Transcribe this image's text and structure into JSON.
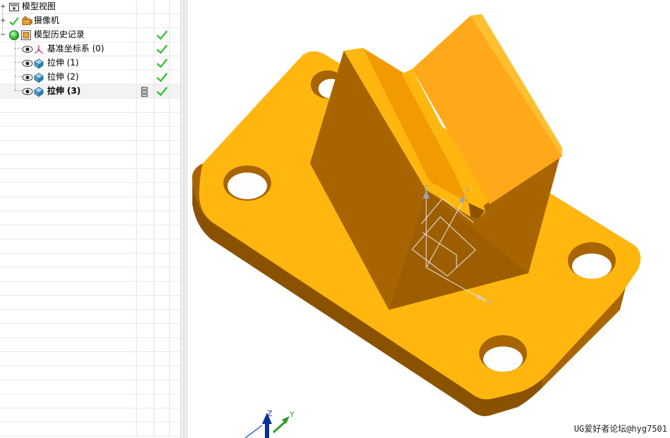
{
  "navigator": {
    "nodes": [
      {
        "label": "模型视图",
        "icon": "model-views-icon",
        "expander": "+"
      },
      {
        "label": "摄像机",
        "icon": "camera-icon",
        "expander": "+"
      },
      {
        "label": "模型历史记录",
        "icon": "model-history-icon",
        "expander": "-"
      },
      {
        "label": "基准坐标系 (0)",
        "icon": "datum-csys-icon"
      },
      {
        "label": "拉伸 (1)",
        "icon": "extrude-icon"
      },
      {
        "label": "拉伸 (2)",
        "icon": "extrude-icon"
      },
      {
        "label": "拉伸 (3)",
        "icon": "extrude-icon",
        "bold": true
      }
    ]
  },
  "viewport": {
    "triad": {
      "x": "X",
      "y": "Y",
      "z": "Z"
    },
    "view_triad": {
      "y": "Y",
      "z": "Z"
    },
    "watermark": "UG爱好者论坛@hyg7501"
  },
  "colors": {
    "part_top": "#FFB70F",
    "part_side": "#A86400",
    "part_side_dark": "#8A5200",
    "accent_check": "#2BBF2B"
  }
}
